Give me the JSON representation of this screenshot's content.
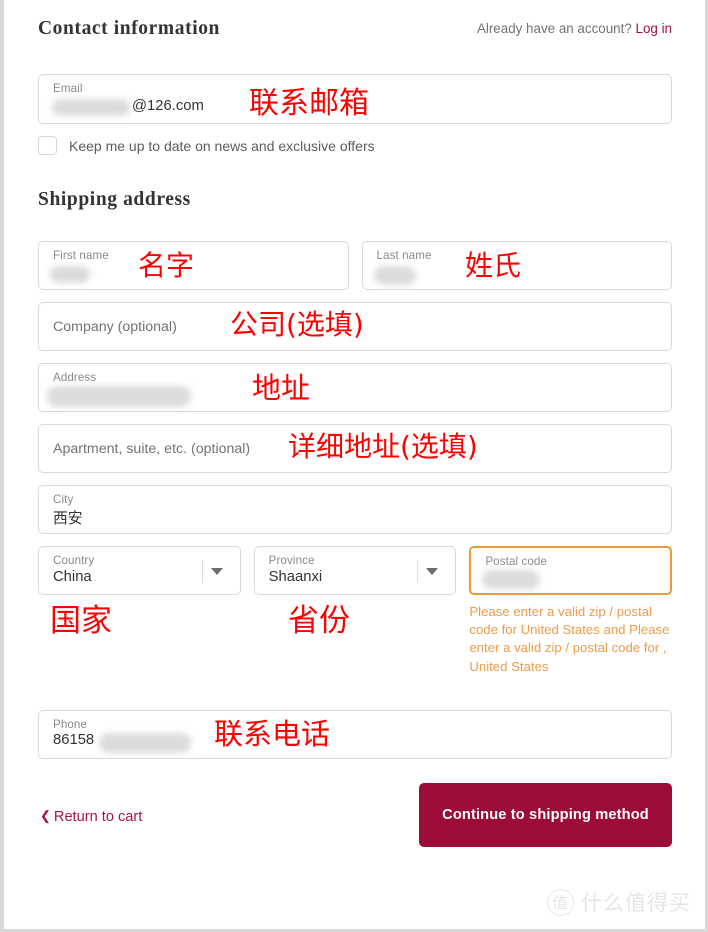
{
  "contact": {
    "title": "Contact information",
    "account_prompt": "Already have an account?",
    "login_label": "Log in",
    "email": {
      "label": "Email",
      "value": "@126.com",
      "annotation": "联系邮箱"
    },
    "newsletter": {
      "label": "Keep me up to date on news and exclusive offers",
      "checked": false
    }
  },
  "shipping": {
    "title": "Shipping address",
    "fields": {
      "first_name": {
        "label": "First name",
        "value": "",
        "annotation": "名字"
      },
      "last_name": {
        "label": "Last name",
        "value": "",
        "annotation": "姓氏"
      },
      "company": {
        "label": "Company (optional)",
        "value": "",
        "annotation": "公司(选填)"
      },
      "address": {
        "label": "Address",
        "value": "",
        "annotation": "地址"
      },
      "apartment": {
        "label": "Apartment, suite, etc. (optional)",
        "value": "",
        "annotation": "详细地址(选填)"
      },
      "city": {
        "label": "City",
        "value": "西安",
        "annotation": ""
      },
      "country": {
        "label": "Country",
        "value": "China",
        "annotation": "国家"
      },
      "province": {
        "label": "Province",
        "value": "Shaanxi",
        "annotation": "省份"
      },
      "postal_code": {
        "label": "Postal code",
        "value": "",
        "annotation": "",
        "error": "Please enter a valid zip / postal code for United States and Please enter a valid zip / postal code for , United States"
      },
      "phone": {
        "label": "Phone",
        "value": "86158",
        "annotation": "联系电话"
      }
    }
  },
  "footer": {
    "return_chevron": "❮",
    "return_label": "Return to cart",
    "continue_label": "Continue to shipping method"
  },
  "watermark": {
    "badge": "值",
    "text": "什么值得买"
  },
  "colors": {
    "brand_crimson": "#9d0b39",
    "link_crimson": "#a20f3c",
    "error_orange": "#ec9c4c",
    "error_border": "#e89a3c",
    "annotation_red": "#ff0000",
    "field_border": "#d9d9d9"
  }
}
